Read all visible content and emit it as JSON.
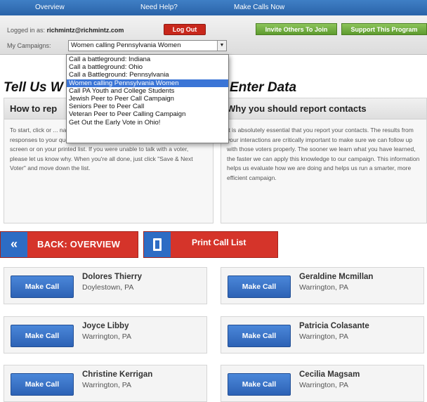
{
  "nav": {
    "items": [
      "Overview",
      "Need Help?",
      "Make Calls Now"
    ]
  },
  "header": {
    "logged_in_prefix": "Logged in as:",
    "logged_in_user": "richmintz@richmintz.com",
    "logout_label": "Log Out",
    "invite_label": "Invite Others To Join",
    "support_label": "Support This Program",
    "campaigns_label": "My Campaigns:",
    "campaign_selected": "Women calling Pennsylvania Women",
    "select_arrow": "▼"
  },
  "dropdown": {
    "options": [
      "Call a battleground: Indiana",
      "Call a battleground: Ohio",
      "Call a Battleground: Pennsylvania",
      "Women calling Pennsylvania Women",
      "Call PA Youth and College Students",
      "Jewish Peer to Peer Call Campaign",
      "Seniors Peer to Peer Call",
      "Veteran Peer to Peer Calling Campaign",
      "Get Out the Early Vote in Ohio!"
    ],
    "selected_index": 3
  },
  "left": {
    "title": "Tell Us W",
    "panel_title": "How to rep",
    "panel_text": "To start, click or ... name of a voter ... on your list, keep track of their responses to your questions by marking their response either on your screen or on your printed list. If you were unable to talk with a voter, please let us know why. When you're all done, just click \"Save & Next Voter\" and move down the list."
  },
  "right": {
    "title": "Enter Data",
    "panel_title": "Why you should report contacts",
    "panel_text": "It is absolutely essential that you report your contacts. The results from your interactions are critically important to make sure we can follow up with those voters properly. The sooner we learn what you have learned, the faster we can apply this knowledge to our campaign. This information helps us evaluate how we are doing and helps us run a smarter, more efficient campaign."
  },
  "actions": {
    "back_arrow": "«",
    "back_label": "BACK: OVERVIEW",
    "print_label": "Print Call List"
  },
  "voters": [
    {
      "name": "Dolores Thierry",
      "location": "Doylestown, PA",
      "call_label": "Make Call"
    },
    {
      "name": "Geraldine Mcmillan",
      "location": "Warrington, PA",
      "call_label": "Make Call"
    },
    {
      "name": "Joyce Libby",
      "location": "Warrington, PA",
      "call_label": "Make Call"
    },
    {
      "name": "Patricia Colasante",
      "location": "Warrington, PA",
      "call_label": "Make Call"
    },
    {
      "name": "Christine Kerrigan",
      "location": "Warrington, PA",
      "call_label": "Make Call"
    },
    {
      "name": "Cecilia Magsam",
      "location": "Warrington, PA",
      "call_label": "Make Call"
    }
  ]
}
